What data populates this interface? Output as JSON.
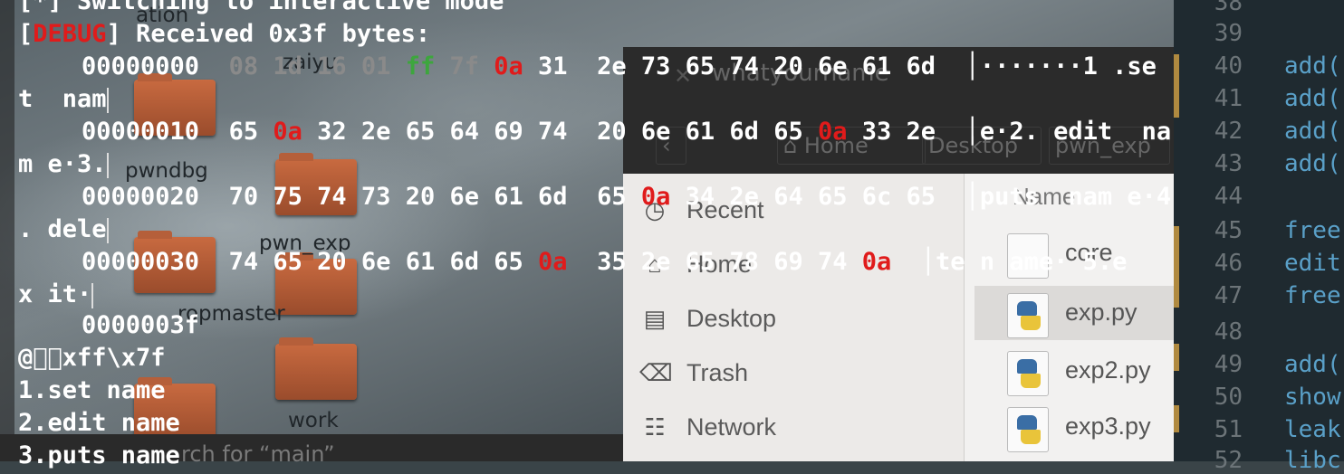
{
  "desktop": {
    "folders": [
      "zaiyu",
      "pwndbg",
      "pwn_exp",
      "ropmaster",
      "work"
    ],
    "partial_label": "ation"
  },
  "nautilus": {
    "window_title": "whatyourname",
    "breadcrumb_home": "Home",
    "breadcrumb_desktop": "Desktop",
    "breadcrumb_current": "pwn_exp",
    "column_header": "Name",
    "sidebar": [
      {
        "label": "Recent",
        "icon": "clock-icon"
      },
      {
        "label": "Home",
        "icon": "home-icon"
      },
      {
        "label": "Desktop",
        "icon": "folder-icon"
      },
      {
        "label": "Trash",
        "icon": "trash-icon"
      },
      {
        "label": "Network",
        "icon": "network-icon"
      }
    ],
    "files": [
      "core",
      "exp.py",
      "exp2.py",
      "exp3.py"
    ],
    "search_hint": "rch for “main”"
  },
  "editor": {
    "line_numbers": [
      "38",
      "39",
      "40",
      "41",
      "42",
      "43",
      "44",
      "45",
      "46",
      "47",
      "48",
      "49",
      "50",
      "51",
      "52"
    ],
    "code": [
      "",
      "",
      "add(",
      "add(",
      "add(",
      "add(",
      "",
      "free",
      "edit",
      "free",
      "",
      "add(",
      "show",
      "leak",
      "libc"
    ]
  },
  "terminal": {
    "line0": "[*] Switching to interactive mode",
    "debug_open": "[",
    "debug_tag": "DEBUG",
    "debug_rest": "] Received 0x3f bytes:",
    "hex_rows": [
      {
        "offset": "00000000",
        "bytes": [
          "08",
          "1d",
          "16",
          "01",
          "ff",
          "7f",
          "0a",
          "31",
          "2e",
          "73",
          "65",
          "74",
          "20",
          "6e",
          "61",
          "6d"
        ],
        "ascii": "·······1 .se",
        "wrap": "t  nam"
      },
      {
        "offset": "00000010",
        "bytes": [
          "65",
          "0a",
          "32",
          "2e",
          "65",
          "64",
          "69",
          "74",
          "20",
          "6e",
          "61",
          "6d",
          "65",
          "0a",
          "33",
          "2e"
        ],
        "ascii": "e·2. edit  na",
        "wrap": "m e·3."
      },
      {
        "offset": "00000020",
        "bytes": [
          "70",
          "75",
          "74",
          "73",
          "20",
          "6e",
          "61",
          "6d",
          "65",
          "0a",
          "34",
          "2e",
          "64",
          "65",
          "6c",
          "65"
        ],
        "ascii": "puts  nam e·4",
        "wrap": ". dele"
      },
      {
        "offset": "00000030",
        "bytes": [
          "74",
          "65",
          "20",
          "6e",
          "61",
          "6d",
          "65",
          "0a",
          "35",
          "2e",
          "65",
          "78",
          "69",
          "74",
          "0a"
        ],
        "ascii": "te n ame· 5.e",
        "wrap": "x it·"
      }
    ],
    "end_offset": "0000003f",
    "raw_line": "@\u0000\u0000xff\\x7f",
    "menu": [
      "1.set name",
      "2.edit name",
      "3.puts name"
    ]
  }
}
